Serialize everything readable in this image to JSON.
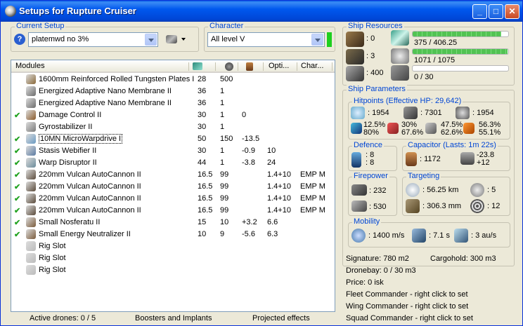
{
  "window": {
    "title": "Setups for Rupture Cruiser"
  },
  "current_setup": {
    "label": "Current Setup",
    "value": "platemwd no 3%"
  },
  "character": {
    "label": "Character",
    "value": "All level V"
  },
  "modules": {
    "headers": [
      "Modules",
      "",
      "",
      "",
      "Opti...",
      "Char..."
    ],
    "rows": [
      {
        "checked": false,
        "name": "1600mm Reinforced Rolled Tungsten Plates I",
        "c1": "28",
        "c2": "500",
        "c3": "",
        "c4": "",
        "c5": "",
        "icon": "armor-plate-icon",
        "color": "#8a6a3a"
      },
      {
        "checked": false,
        "name": "Energized Adaptive Nano Membrane II",
        "c1": "36",
        "c2": "1",
        "c3": "",
        "c4": "",
        "c5": "",
        "icon": "membrane-icon",
        "color": "#6c6c6c"
      },
      {
        "checked": false,
        "name": "Energized Adaptive Nano Membrane II",
        "c1": "36",
        "c2": "1",
        "c3": "",
        "c4": "",
        "c5": "",
        "icon": "membrane-icon",
        "color": "#6c6c6c"
      },
      {
        "checked": true,
        "name": "Damage Control II",
        "c1": "30",
        "c2": "1",
        "c3": "0",
        "c4": "",
        "c5": "",
        "icon": "damage-control-icon",
        "color": "#8a5a2a"
      },
      {
        "checked": false,
        "name": "Gyrostabilizer II",
        "c1": "30",
        "c2": "1",
        "c3": "",
        "c4": "",
        "c5": "",
        "icon": "gyrostabilizer-icon",
        "color": "#7a7a7a"
      },
      {
        "checked": true,
        "name": "10MN MicroWarpdrive I",
        "c1": "50",
        "c2": "150",
        "c3": "-13.5",
        "c4": "",
        "c5": "",
        "icon": "mwd-icon",
        "color": "#6a9ac2",
        "selected": true
      },
      {
        "checked": true,
        "name": "Stasis Webifier II",
        "c1": "30",
        "c2": "1",
        "c3": "-0.9",
        "c4": "10",
        "c5": "",
        "icon": "webifier-icon",
        "color": "#5a7aa2"
      },
      {
        "checked": true,
        "name": "Warp Disruptor II",
        "c1": "44",
        "c2": "1",
        "c3": "-3.8",
        "c4": "24",
        "c5": "",
        "icon": "disruptor-icon",
        "color": "#6a8a9a"
      },
      {
        "checked": true,
        "name": "220mm Vulcan AutoCannon II",
        "c1": "16.5",
        "c2": "99",
        "c3": "",
        "c4": "1.4+10",
        "c5": "EMP M",
        "icon": "autocannon-icon",
        "color": "#5a4a3a"
      },
      {
        "checked": true,
        "name": "220mm Vulcan AutoCannon II",
        "c1": "16.5",
        "c2": "99",
        "c3": "",
        "c4": "1.4+10",
        "c5": "EMP M",
        "icon": "autocannon-icon",
        "color": "#5a4a3a"
      },
      {
        "checked": true,
        "name": "220mm Vulcan AutoCannon II",
        "c1": "16.5",
        "c2": "99",
        "c3": "",
        "c4": "1.4+10",
        "c5": "EMP M",
        "icon": "autocannon-icon",
        "color": "#5a4a3a"
      },
      {
        "checked": true,
        "name": "220mm Vulcan AutoCannon II",
        "c1": "16.5",
        "c2": "99",
        "c3": "",
        "c4": "1.4+10",
        "c5": "EMP M",
        "icon": "autocannon-icon",
        "color": "#5a4a3a"
      },
      {
        "checked": true,
        "name": "Small Nosferatu II",
        "c1": "15",
        "c2": "10",
        "c3": "+3.2",
        "c4": "6.6",
        "c5": "",
        "icon": "nosferatu-icon",
        "color": "#7a5a3a"
      },
      {
        "checked": true,
        "name": "Small Energy Neutralizer II",
        "c1": "10",
        "c2": "9",
        "c3": "-5.6",
        "c4": "6.3",
        "c5": "",
        "icon": "neutralizer-icon",
        "color": "#7a5a3a"
      },
      {
        "checked": false,
        "name": "Rig Slot",
        "c1": "",
        "c2": "",
        "c3": "",
        "c4": "",
        "c5": "",
        "icon": "empty-slot-icon",
        "color": "#bbbbbb"
      },
      {
        "checked": false,
        "name": "Rig Slot",
        "c1": "",
        "c2": "",
        "c3": "",
        "c4": "",
        "c5": "",
        "icon": "empty-slot-icon",
        "color": "#bbbbbb"
      },
      {
        "checked": false,
        "name": "Rig Slot",
        "c1": "",
        "c2": "",
        "c3": "",
        "c4": "",
        "c5": "",
        "icon": "empty-slot-icon",
        "color": "#bbbbbb"
      }
    ]
  },
  "status": {
    "drones": "Active drones: 0 / 5",
    "boosters": "Boosters and Implants",
    "projected": "Projected effects"
  },
  "resources": {
    "label": "Ship Resources",
    "turrets": ": 0",
    "launchers": ": 3",
    "drone_bay": ": 400",
    "cpu": "375 / 406.25",
    "cpu_fraction": 0.923,
    "powergrid": "1071 / 1075",
    "powergrid_fraction": 0.996,
    "calibration": "0 / 30",
    "calibration_fraction": 0.0
  },
  "params": {
    "label": "Ship Parameters",
    "hitpoints_label": "Hitpoints (Effective HP: 29,642)",
    "shield_hp": ": 1954",
    "armor_hp": ": 7301",
    "structure_hp": ": 1954",
    "res1": "12.5%",
    "res2": "80%",
    "res3": "30%",
    "res4": "67.6%",
    "res5": "47.5%",
    "res6": "62.6%",
    "res7": "56.3%",
    "res8": "55.1%",
    "defence_label": "Defence",
    "def1": ": 8",
    "def2": ": 8",
    "capacitor_label": "Capacitor (Lasts: 1m 22s)",
    "cap_amount": ": 1172",
    "cap_recharge": "-23.8",
    "cap_plus": "+12",
    "firepower_label": "Firepower",
    "fp1": ": 232",
    "fp2": ": 530",
    "targeting_label": "Targeting",
    "range": ": 56.25 km",
    "targets": ": 5",
    "scan_res": ": 306.3 mm",
    "sensor": ": 12",
    "mobility_label": "Mobility",
    "speed": ": 1400 m/s",
    "align": ": 7.1 s",
    "warp": ": 3 au/s"
  },
  "footer": {
    "signature": "Signature: 780 m2",
    "cargohold": "Cargohold: 300 m3",
    "dronebay": "Dronebay: 0 / 30 m3",
    "price": "Price: 0 isk",
    "fleet": "Fleet Commander - right click to set",
    "wing": "Wing Commander - right click to set",
    "squad": "Squad Commander - right click to set"
  }
}
